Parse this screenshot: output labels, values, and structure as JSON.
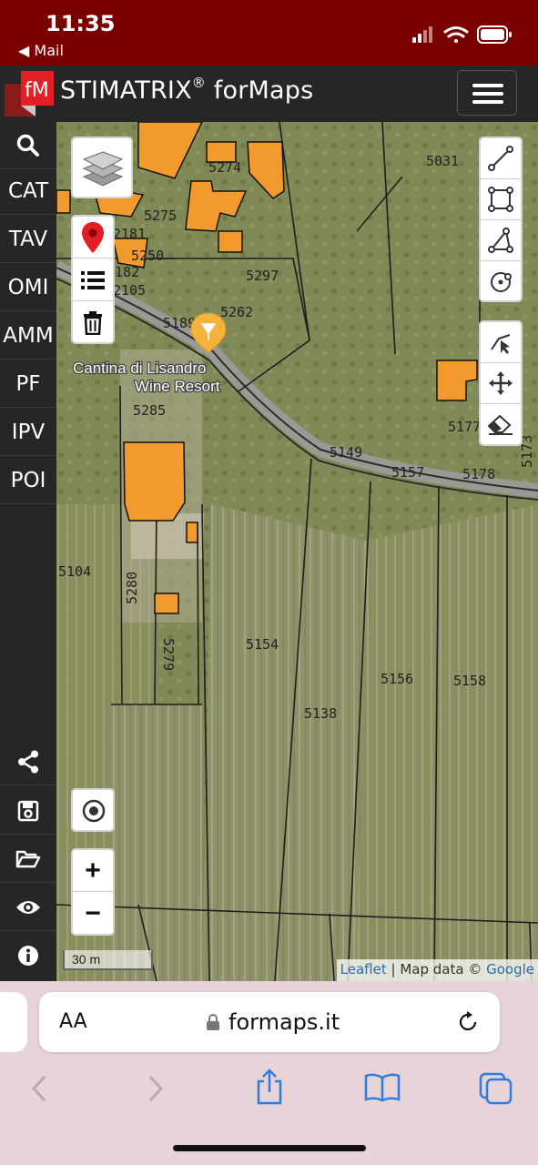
{
  "status_bar": {
    "time": "11:35",
    "back_label": "◀ Mail",
    "icons": [
      "signal-icon",
      "wifi-icon",
      "battery-icon"
    ],
    "background_color": "#7a0000"
  },
  "app": {
    "logo_text": "fM",
    "title": "STIMATRIX",
    "title_sup": "®",
    "title_suffix": " forMaps",
    "menu_icon": "hamburger-icon",
    "accent_color": "#e31e24"
  },
  "sidebar": {
    "items": [
      {
        "label": "",
        "icon": "search-icon"
      },
      {
        "label": "CAT"
      },
      {
        "label": "TAV"
      },
      {
        "label": "OMI"
      },
      {
        "label": "AMM"
      },
      {
        "label": "PF"
      },
      {
        "label": "IPV"
      },
      {
        "label": "POI"
      }
    ],
    "bottom_icons": [
      "share-icon",
      "save-icon",
      "folder-open-icon",
      "eye-icon",
      "info-icon"
    ]
  },
  "map": {
    "place_label_line1": "Cantina di Lisandro",
    "place_label_line2": "Wine Resort",
    "parcels": [
      "5031",
      "5274",
      "5275",
      "2181",
      "5250",
      "2182",
      "2105",
      "5297",
      "5262",
      "5189",
      "5285",
      "5177",
      "5149",
      "5157",
      "5178",
      "5104",
      "5280",
      "5279",
      "5154",
      "5156",
      "5158",
      "5138",
      "5173"
    ],
    "scale_label": "30 m",
    "attribution_link1": "Leaflet",
    "attribution_text": " | Map data © ",
    "attribution_link2": "Google",
    "zoom_in": "+",
    "zoom_out": "−",
    "left_tools": [
      "layers-icon",
      "map-marker-icon",
      "list-icon",
      "trash-icon"
    ],
    "draw_tools": [
      "polyline-icon",
      "rectangle-icon",
      "polygon-icon",
      "circle-icon"
    ],
    "edit_tools": [
      "cut-icon",
      "move-icon",
      "eraser-icon"
    ],
    "locate_icon": "locate-icon",
    "building_color": "#f29a2e"
  },
  "browser": {
    "aa_label": "AA",
    "url": "formaps.it",
    "icons": [
      "lock-icon",
      "reload-icon",
      "back-icon",
      "forward-icon",
      "share-icon",
      "bookmarks-icon",
      "tabs-icon"
    ]
  }
}
